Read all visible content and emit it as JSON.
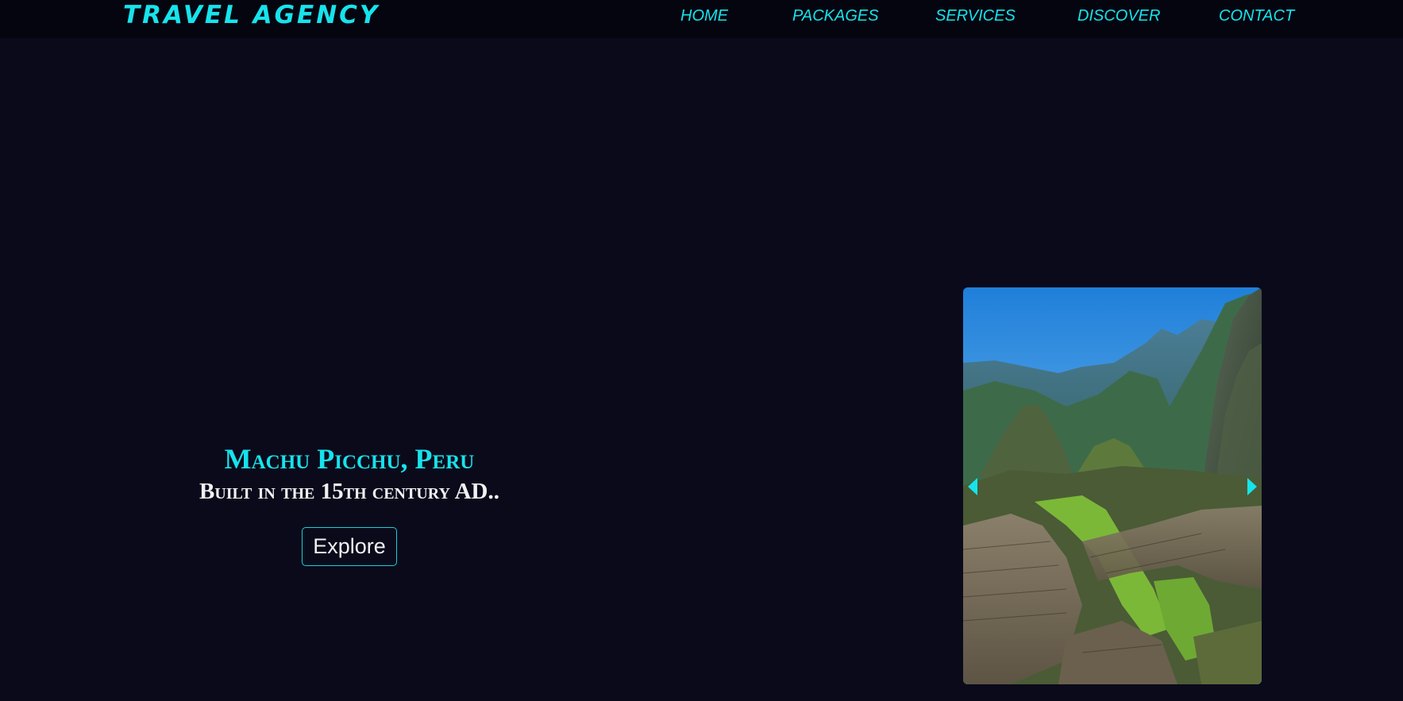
{
  "brand": {
    "name": "TRAVEL AGENCY",
    "color": "#16e3ec"
  },
  "nav": {
    "items": [
      {
        "label": "HOME"
      },
      {
        "label": "PACKAGES"
      },
      {
        "label": "SERVICES"
      },
      {
        "label": "DISCOVER"
      },
      {
        "label": "CONTACT"
      }
    ]
  },
  "hero": {
    "title": "Machu Picchu, Peru",
    "subtitle": "Built in the 15th century AD..",
    "button_label": "Explore"
  },
  "slider": {
    "image_name": "machu-picchu-photo",
    "prev_icon": "triangle-left-icon",
    "next_icon": "triangle-right-icon"
  },
  "colors": {
    "background": "#0b0a1b",
    "navbar": "#050510",
    "accent": "#16e3ec",
    "text": "#f1f1f1"
  }
}
